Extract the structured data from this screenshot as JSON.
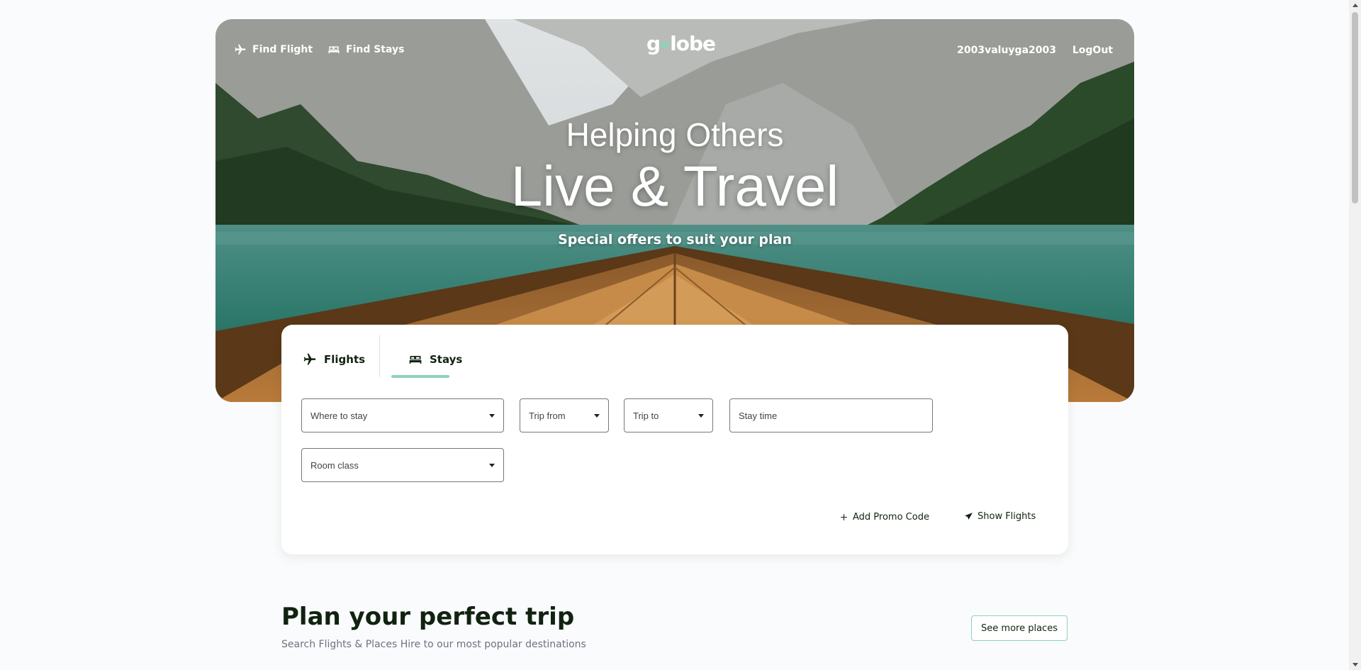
{
  "nav": {
    "find_flight": "Find Flight",
    "find_stays": "Find Stays",
    "logo_prefix": "g",
    "logo_suffix": "lobe",
    "username": "2003valuyga2003",
    "logout": "LogOut"
  },
  "hero": {
    "subtitle": "Helping Others",
    "title": "Live & Travel",
    "tagline": "Special offers to suit your plan"
  },
  "search": {
    "tabs": [
      {
        "label": "Flights",
        "icon": "airplane-icon",
        "active": false
      },
      {
        "label": "Stays",
        "icon": "bed-icon",
        "active": true
      }
    ],
    "fields": {
      "where": "Where to stay",
      "trip_from": "Trip from",
      "trip_to": "Trip to",
      "stay_time": "Stay time",
      "room_class": "Room class"
    },
    "add_promo": "Add Promo Code",
    "show": "Show Flights"
  },
  "section": {
    "title": "Plan your perfect trip",
    "subtitle": "Search Flights & Places Hire to our most popular destinations",
    "see_more": "See more places"
  },
  "colors": {
    "accent": "#8dd3bb",
    "text": "#112211",
    "lake": "#2f7a6c"
  }
}
